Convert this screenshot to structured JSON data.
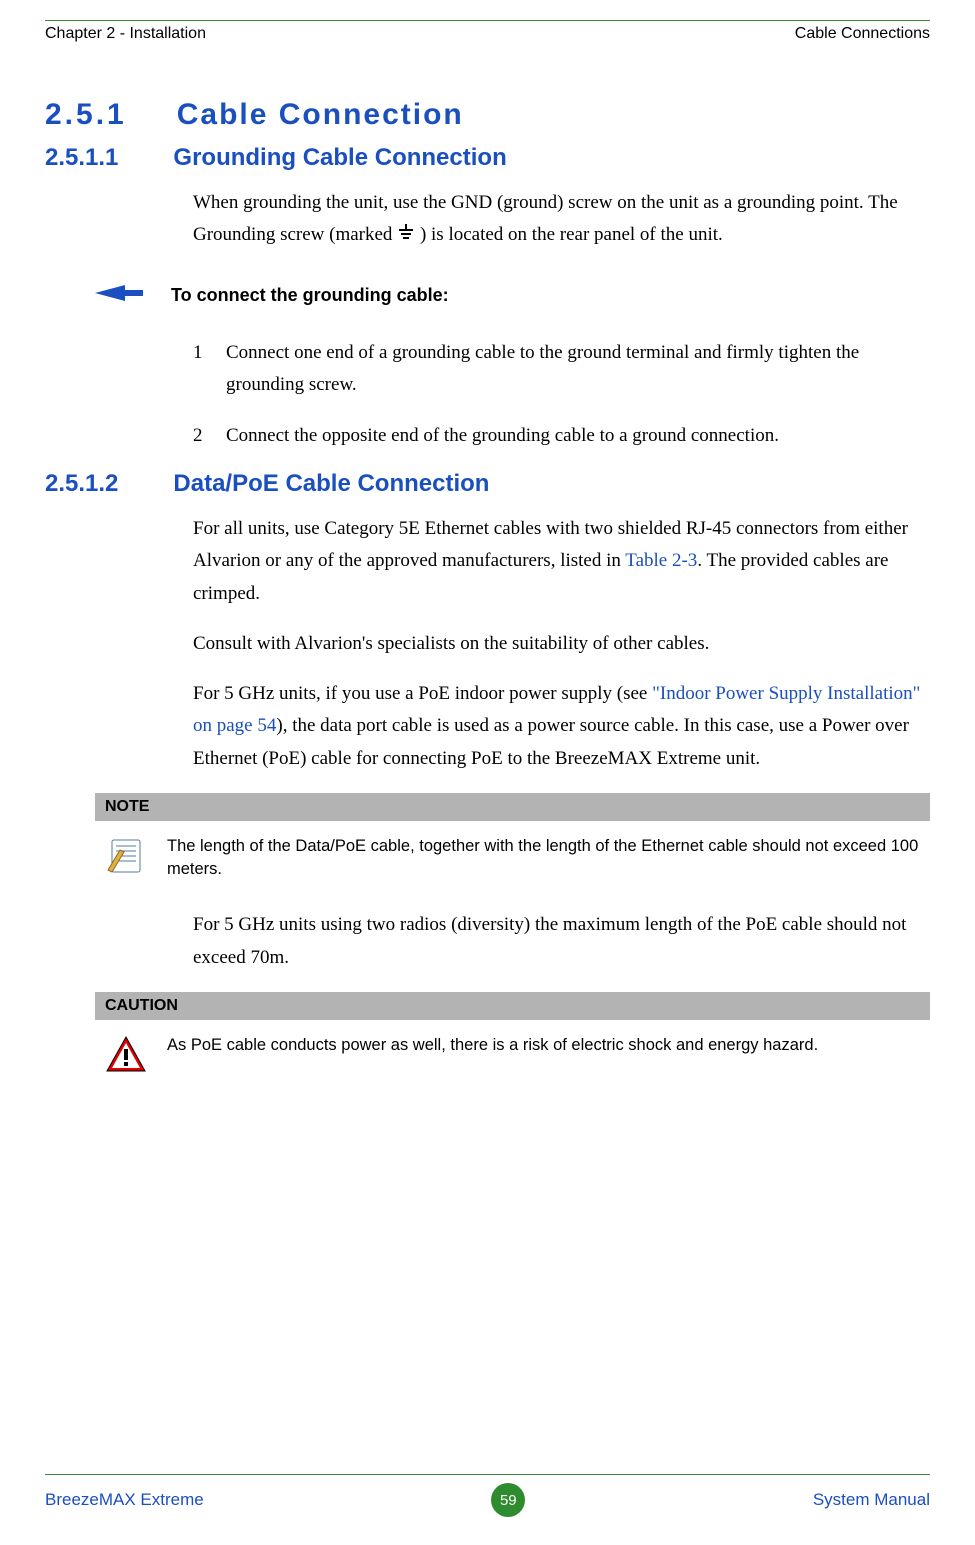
{
  "header": {
    "left": "Chapter 2 - Installation",
    "right": "Cable Connections"
  },
  "section": {
    "num": "2.5.1",
    "title": "Cable Connection"
  },
  "sub1": {
    "num": "2.5.1.1",
    "title": "Grounding Cable Connection",
    "p1a": "When grounding the unit, use the GND (ground) screw on the unit as a grounding point. The Grounding screw (marked ",
    "p1b": ") is located on the rear panel of the unit.",
    "procTitle": "To connect the grounding cable:",
    "steps": {
      "n1": "1",
      "t1": "Connect one end of a grounding cable to the ground terminal and firmly tighten the grounding screw.",
      "n2": "2",
      "t2": "Connect the opposite end of the grounding cable to a ground connection."
    }
  },
  "sub2": {
    "num": "2.5.1.2",
    "title": "Data/PoE Cable Connection",
    "p1a": "For all units, use Category 5E Ethernet cables with two shielded RJ-45 connectors from either Alvarion or any of the approved manufacturers, listed in ",
    "p1link": "Table 2-3",
    "p1b": ". The provided cables are crimped.",
    "p2": "Consult with Alvarion's specialists on the suitability of other cables.",
    "p3a": "For 5 GHz units, if you use a PoE indoor power supply (see ",
    "p3link": "\"Indoor Power Supply Installation\" on page 54",
    "p3b": "), the data port cable is used as a power source cable. In this case, use a Power over Ethernet (PoE) cable for connecting PoE to the BreezeMAX Extreme unit.",
    "note": {
      "label": "NOTE",
      "text": "The length of the Data/PoE cable, together with the length of the Ethernet cable should not exceed 100 meters."
    },
    "p4": "For 5 GHz units using two radios (diversity) the maximum length of the PoE cable should not exceed 70m.",
    "caution": {
      "label": "CAUTION",
      "text": "As PoE cable conducts power as well, there is a risk of electric shock and energy hazard."
    }
  },
  "footer": {
    "left": "BreezeMAX Extreme",
    "page": "59",
    "right": "System Manual"
  }
}
